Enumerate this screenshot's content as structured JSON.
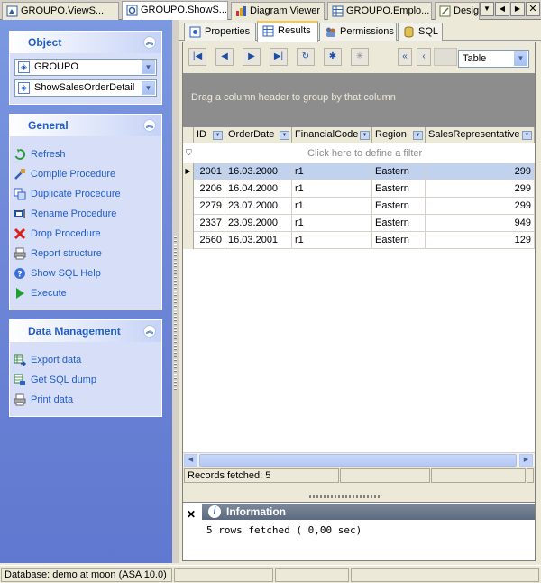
{
  "doc_tabs": [
    {
      "label": "GROUPO.ViewS...",
      "icon": "view-icon"
    },
    {
      "label": "GROUPO.ShowS...",
      "icon": "procedure-icon",
      "active": true
    },
    {
      "label": "Diagram Viewer",
      "icon": "diagram-icon"
    },
    {
      "label": "GROUPO.Emplo...",
      "icon": "table-icon"
    },
    {
      "label": "Desig",
      "icon": "designer-icon"
    }
  ],
  "object_panel": {
    "title": "Object",
    "database": "GROUPO",
    "procedure": "ShowSalesOrderDetail"
  },
  "general_panel": {
    "title": "General",
    "items": [
      {
        "label": "Refresh",
        "icon": "refresh-icon"
      },
      {
        "label": "Compile Procedure",
        "icon": "compile-icon"
      },
      {
        "label": "Duplicate Procedure",
        "icon": "duplicate-icon"
      },
      {
        "label": "Rename Procedure",
        "icon": "rename-icon"
      },
      {
        "label": "Drop Procedure",
        "icon": "drop-icon"
      },
      {
        "label": "Report structure",
        "icon": "printer-icon"
      },
      {
        "label": "Show SQL Help",
        "icon": "help-icon"
      },
      {
        "label": "Execute",
        "icon": "execute-icon"
      }
    ]
  },
  "data_panel": {
    "title": "Data Management",
    "items": [
      {
        "label": "Export data",
        "icon": "export-icon"
      },
      {
        "label": "Get SQL dump",
        "icon": "sql-dump-icon"
      },
      {
        "label": "Print data",
        "icon": "printer-icon"
      }
    ]
  },
  "sub_tabs": [
    {
      "label": "Properties",
      "icon": "properties-icon"
    },
    {
      "label": "Results",
      "icon": "results-icon",
      "active": true
    },
    {
      "label": "Permissions",
      "icon": "permissions-icon"
    },
    {
      "label": "SQL",
      "icon": "sql-icon"
    }
  ],
  "view_mode": "Table",
  "group_hint": "Drag a column header to group by that column",
  "filter_hint": "Click here to define a filter",
  "columns": [
    "ID",
    "OrderDate",
    "FinancialCode",
    "Region",
    "SalesRepresentative"
  ],
  "rows": [
    [
      "2001",
      "16.03.2000",
      "r1",
      "Eastern",
      "299"
    ],
    [
      "2206",
      "16.04.2000",
      "r1",
      "Eastern",
      "299"
    ],
    [
      "2279",
      "23.07.2000",
      "r1",
      "Eastern",
      "299"
    ],
    [
      "2337",
      "23.09.2000",
      "r1",
      "Eastern",
      "949"
    ],
    [
      "2560",
      "16.03.2001",
      "r1",
      "Eastern",
      "129"
    ]
  ],
  "records_status": "Records fetched: 5",
  "info": {
    "title": "Information",
    "message": "5 rows fetched ( 0,00 sec)"
  },
  "status_bar": "Database: demo at moon (ASA 10.0)",
  "colors": {
    "accent": "#215dc6",
    "panel_bg": "#d6dff7",
    "selection": "#c1d2ee"
  }
}
